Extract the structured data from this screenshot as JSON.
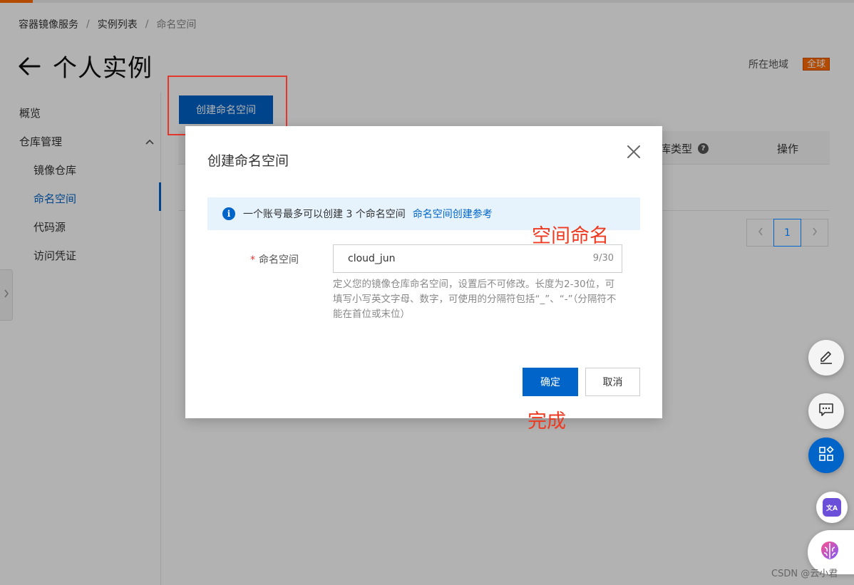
{
  "breadcrumb": {
    "items": [
      "容器镜像服务",
      "实例列表",
      "命名空间"
    ],
    "separator": "/"
  },
  "page": {
    "title": "个人实例"
  },
  "region": {
    "label": "所在地域",
    "value": "全球"
  },
  "sidebar": {
    "overview": "概览",
    "group": {
      "label": "仓库管理"
    },
    "subitems": [
      {
        "label": "镜像仓库"
      },
      {
        "label": "命名空间"
      },
      {
        "label": "代码源"
      },
      {
        "label": "访问凭证"
      }
    ]
  },
  "toolbar": {
    "create_label": "创建命名空间"
  },
  "table": {
    "header_type": "库类型",
    "header_ops": "操作"
  },
  "pagination": {
    "current": "1"
  },
  "modal": {
    "title": "创建命名空间",
    "notice": "一个账号最多可以创建 3 个命名空间",
    "notice_link": "命名空间创建参考",
    "field_label": "命名空间",
    "field_required_mark": "*",
    "field_value": "cloud_jun",
    "field_counter": "9/30",
    "hint": "定义您的镜像仓库命名空间，设置后不可修改。长度为2-30位，可填写小写英文字母、数字，可使用的分隔符包括“_”、“-”（分隔符不能在首位或末位）",
    "ok_label": "确定",
    "cancel_label": "取消"
  },
  "annotations": {
    "name_hint": "空间命名",
    "done_hint": "完成"
  },
  "float_buttons": {
    "translate_glyph": "文A"
  },
  "watermark": "CSDN @云小君",
  "colors": {
    "primary": "#0064c8",
    "accent_orange": "#ff6a00",
    "annotation_red": "#ee3a21",
    "notice_bg": "#e6f3fd"
  },
  "icons": [
    "back-arrow-icon",
    "chevron-up-icon",
    "chevron-right-icon",
    "question-icon",
    "info-icon",
    "close-icon",
    "edit-icon",
    "chat-icon",
    "apps-icon",
    "translate-icon",
    "brain-icon",
    "chevron-left-icon"
  ]
}
